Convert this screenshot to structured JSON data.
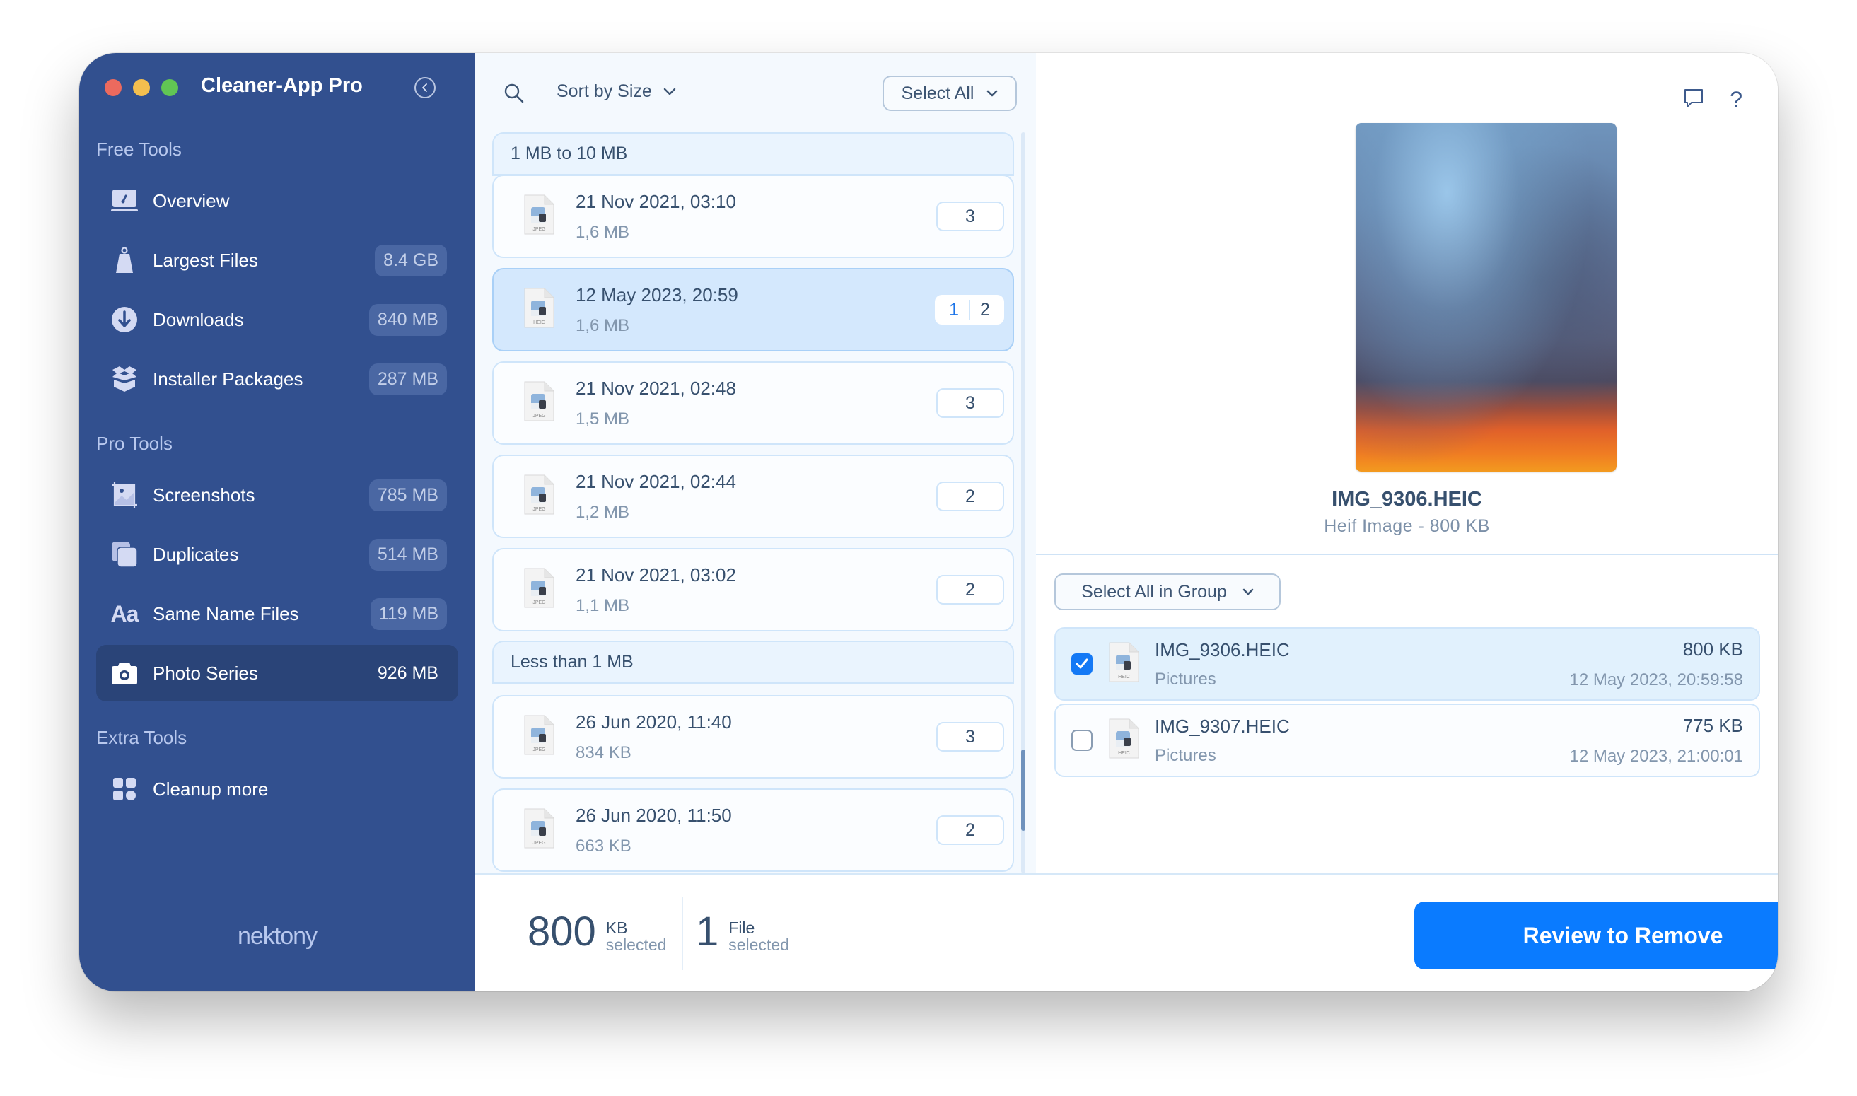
{
  "app": {
    "title": "Cleaner-App Pro",
    "brand": "nektony",
    "accent_color": "#0a7bff",
    "sidebar_color": "#32508f"
  },
  "sidebar": {
    "sections": [
      {
        "label": "Free Tools",
        "items": [
          {
            "label": "Overview",
            "badge": null,
            "icon": "overview-gauge-icon"
          },
          {
            "label": "Largest Files",
            "badge": "8.4 GB",
            "icon": "weight-icon"
          },
          {
            "label": "Downloads",
            "badge": "840 MB",
            "icon": "download-circle-icon"
          },
          {
            "label": "Installer Packages",
            "badge": "287 MB",
            "icon": "open-box-icon"
          }
        ]
      },
      {
        "label": "Pro Tools",
        "items": [
          {
            "label": "Screenshots",
            "badge": "785 MB",
            "icon": "screenshot-crop-icon"
          },
          {
            "label": "Duplicates",
            "badge": "514 MB",
            "icon": "duplicates-icon"
          },
          {
            "label": "Same Name Files",
            "badge": "119 MB",
            "icon": "font-aa-icon"
          },
          {
            "label": "Photo Series",
            "badge": "926 MB",
            "icon": "camera-icon",
            "active": true
          }
        ]
      },
      {
        "label": "Extra Tools",
        "items": [
          {
            "label": "Cleanup more",
            "badge": null,
            "icon": "grid-icon"
          }
        ]
      }
    ]
  },
  "list": {
    "sort_label": "Sort by Size",
    "select_all_label": "Select All",
    "groups": [
      {
        "header": "1 MB to 10 MB",
        "rows": [
          {
            "date": "21 Nov 2021, 03:10",
            "size": "1,6 MB",
            "type": "JPEG",
            "count": "3"
          },
          {
            "date": "12 May 2023, 20:59",
            "size": "1,6 MB",
            "type": "HEIC",
            "selected_count": "1",
            "count": "2",
            "selected": true
          },
          {
            "date": "21 Nov 2021, 02:48",
            "size": "1,5 MB",
            "type": "JPEG",
            "count": "3"
          },
          {
            "date": "21 Nov 2021, 02:44",
            "size": "1,2 MB",
            "type": "JPEG",
            "count": "2"
          },
          {
            "date": "21 Nov 2021, 03:02",
            "size": "1,1 MB",
            "type": "JPEG",
            "count": "2"
          }
        ]
      },
      {
        "header": "Less than 1 MB",
        "rows": [
          {
            "date": "26 Jun 2020, 11:40",
            "size": "834 KB",
            "type": "JPEG",
            "count": "3"
          },
          {
            "date": "26 Jun 2020, 11:50",
            "size": "663 KB",
            "type": "JPEG",
            "count": "2"
          }
        ]
      }
    ]
  },
  "preview": {
    "file_name": "IMG_9306.HEIC",
    "meta": "Heif Image - 800 KB",
    "select_group_label": "Select All in Group",
    "files": [
      {
        "name": "IMG_9306.HEIC",
        "location": "Pictures",
        "size": "800 KB",
        "date": "12 May 2023, 20:59:58",
        "type": "HEIC",
        "checked": true
      },
      {
        "name": "IMG_9307.HEIC",
        "location": "Pictures",
        "size": "775 KB",
        "date": "12 May 2023, 21:00:01",
        "type": "HEIC",
        "checked": false
      }
    ]
  },
  "footer": {
    "size_value": "800",
    "size_unit": "KB",
    "size_label": "selected",
    "files_value": "1",
    "files_unit": "File",
    "files_label": "selected",
    "review_button": "Review to Remove"
  }
}
